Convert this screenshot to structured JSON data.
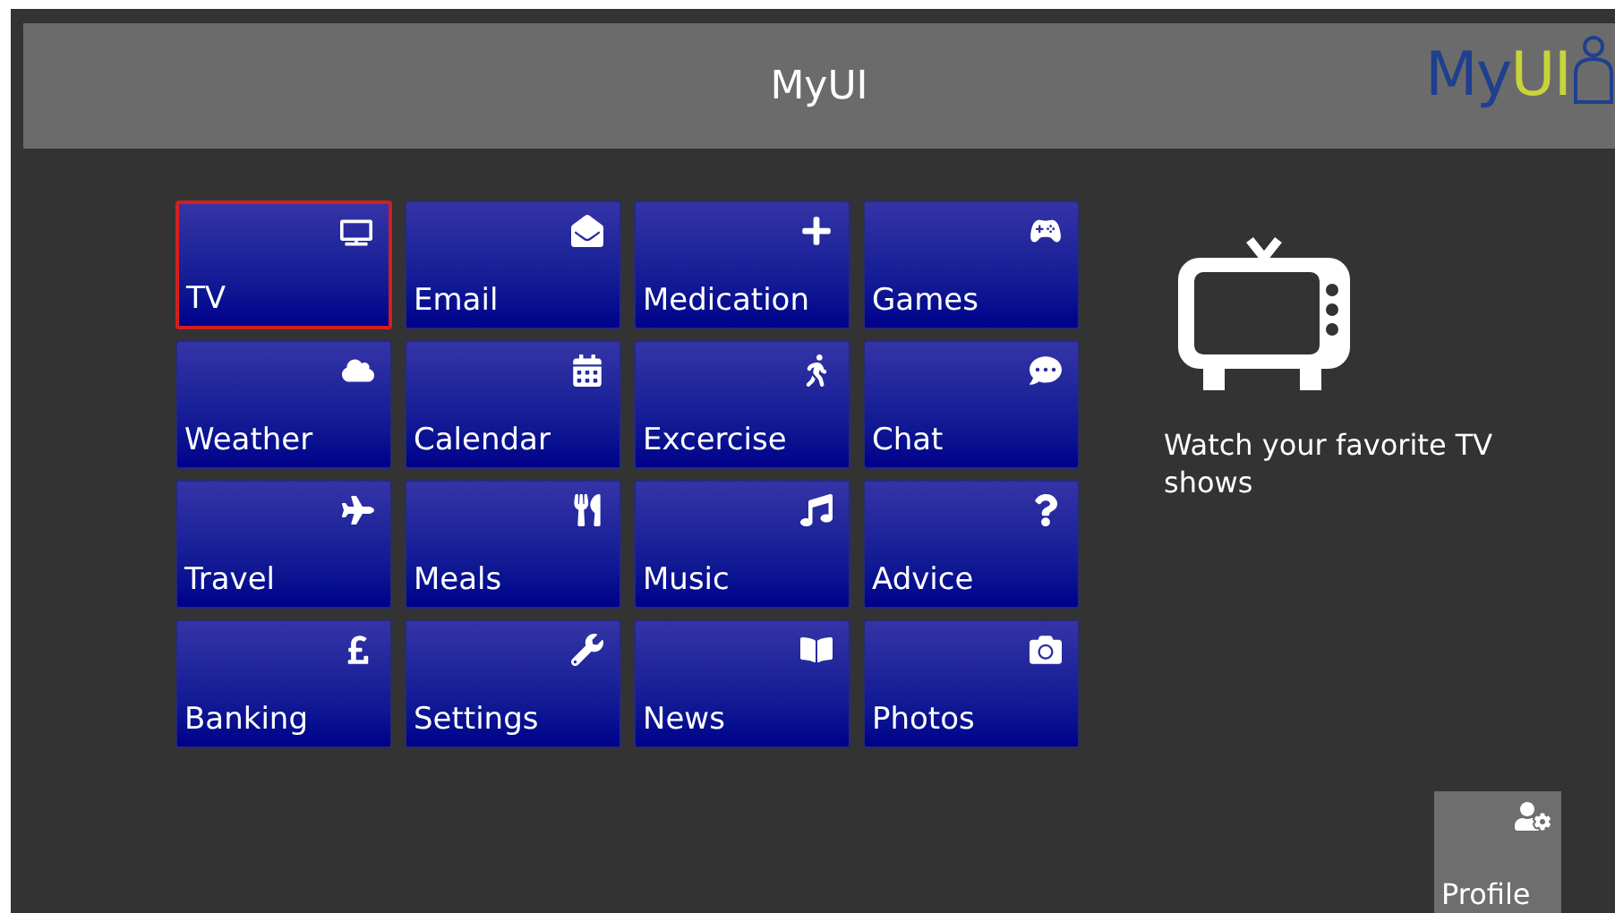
{
  "header": {
    "title": "MyUI",
    "logo": [
      "My",
      "UI"
    ]
  },
  "tiles": [
    {
      "label": "TV",
      "selected": true
    },
    {
      "label": "Email",
      "selected": false
    },
    {
      "label": "Medication",
      "selected": false
    },
    {
      "label": "Games",
      "selected": false
    },
    {
      "label": "Weather",
      "selected": false
    },
    {
      "label": "Calendar",
      "selected": false
    },
    {
      "label": "Excercise",
      "selected": false
    },
    {
      "label": "Chat",
      "selected": false
    },
    {
      "label": "Travel",
      "selected": false
    },
    {
      "label": "Meals",
      "selected": false
    },
    {
      "label": "Music",
      "selected": false
    },
    {
      "label": "Advice",
      "selected": false
    },
    {
      "label": "Banking",
      "selected": false
    },
    {
      "label": "Settings",
      "selected": false
    },
    {
      "label": "News",
      "selected": false
    },
    {
      "label": "Photos",
      "selected": false
    }
  ],
  "detail": {
    "description": "Watch your favorite TV shows"
  },
  "profile": {
    "label": "Profile"
  }
}
